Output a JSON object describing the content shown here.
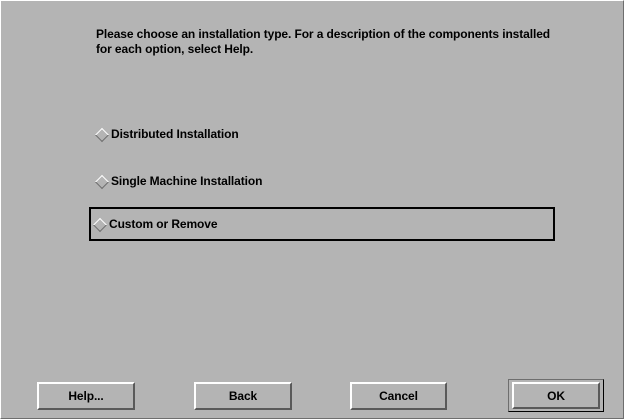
{
  "instructions": "Please choose an installation type.  For a description of the components installed for each option, select Help.",
  "options": [
    {
      "label": "Distributed Installation"
    },
    {
      "label": "Single Machine Installation"
    },
    {
      "label": "Custom or Remove"
    }
  ],
  "buttons": {
    "help": "Help...",
    "back": "Back",
    "cancel": "Cancel",
    "ok": "OK"
  },
  "icons": {
    "radio": "diamond-radio-icon"
  },
  "colors": {
    "background": "#b4b4b4",
    "highlight": "#ffffff",
    "shadow": "#5a5a5a",
    "focus": "#000000"
  }
}
